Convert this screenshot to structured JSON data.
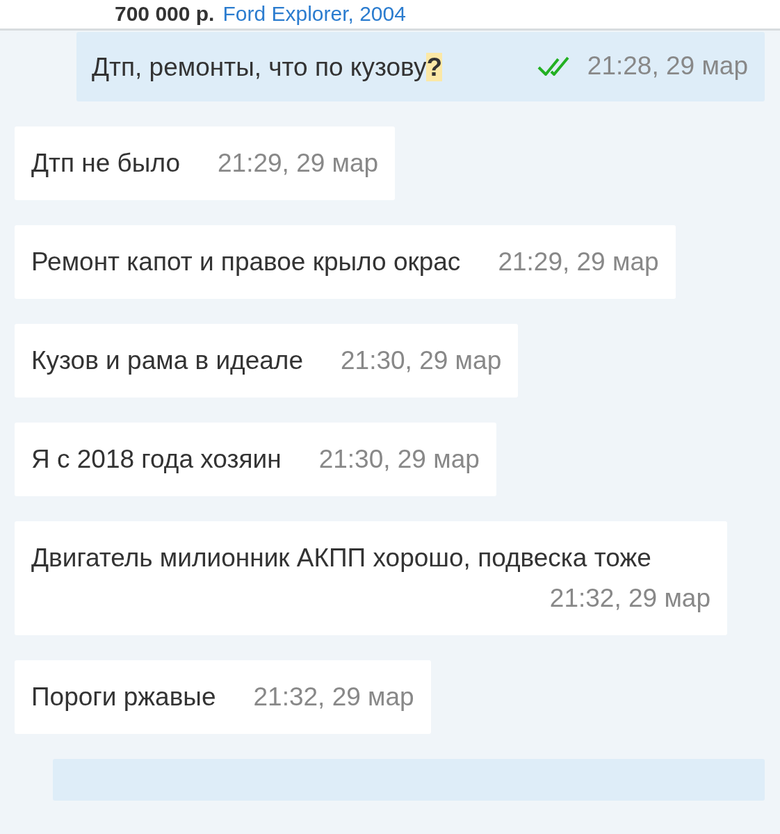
{
  "listing": {
    "price": "700 000 р.",
    "title": "Ford Explorer, 2004"
  },
  "messages": [
    {
      "kind": "outgoing",
      "text": "Дтп, ремонты, что по кузову**?**",
      "read": true,
      "time": "21:28, 29 мар"
    },
    {
      "kind": "incoming",
      "text": "Дтп не было",
      "time": "21:29, 29 мар"
    },
    {
      "kind": "incoming",
      "text": "Ремонт капот и правое крыло окрас",
      "time": "21:29, 29 мар"
    },
    {
      "kind": "incoming",
      "text": "Кузов и рама в идеале",
      "time": "21:30, 29 мар"
    },
    {
      "kind": "incoming",
      "text": "Я с 2018 года хозяин",
      "time": "21:30, 29 мар"
    },
    {
      "kind": "incoming",
      "text": "Двигатель милионник АКПП хорошо, подвеска тоже",
      "time": "21:32, 29 мар"
    },
    {
      "kind": "incoming",
      "text": "Пороги ржавые",
      "time": "21:32, 29 мар"
    },
    {
      "kind": "outgoing_partial"
    }
  ]
}
